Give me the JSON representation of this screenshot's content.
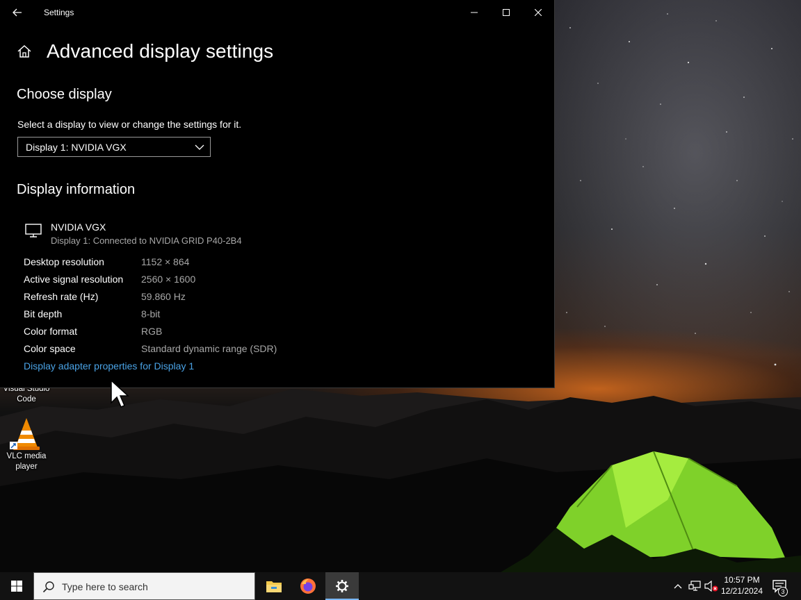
{
  "window": {
    "title": "Settings",
    "page_title": "Advanced display settings"
  },
  "choose_display": {
    "heading": "Choose display",
    "description": "Select a display to view or change the settings for it.",
    "selected": "Display 1: NVIDIA VGX"
  },
  "display_info": {
    "heading": "Display information",
    "monitor_name": "NVIDIA VGX",
    "monitor_subtitle": "Display 1: Connected to NVIDIA GRID P40-2B4",
    "rows": [
      {
        "label": "Desktop resolution",
        "value": "1152 × 864"
      },
      {
        "label": "Active signal resolution",
        "value": "2560 × 1600"
      },
      {
        "label": "Refresh rate (Hz)",
        "value": "59.860 Hz"
      },
      {
        "label": "Bit depth",
        "value": "8-bit"
      },
      {
        "label": "Color format",
        "value": "RGB"
      },
      {
        "label": "Color space",
        "value": "Standard dynamic range (SDR)"
      }
    ],
    "adapter_link": "Display adapter properties for Display 1"
  },
  "desktop_icons": {
    "vscode_label": "Visual Studio Code",
    "vlc_label": "VLC media player"
  },
  "taskbar": {
    "search_placeholder": "Type here to search",
    "time": "10:57 PM",
    "date": "12/21/2024",
    "notification_count": "3"
  },
  "colors": {
    "link": "#4aa3e6",
    "window_bg": "#000000",
    "taskbar_bg": "#121212"
  },
  "icons": [
    "back-arrow-icon",
    "minimize-icon",
    "maximize-icon",
    "close-icon",
    "home-icon",
    "chevron-down-icon",
    "monitor-icon",
    "windows-logo-icon",
    "search-icon",
    "file-explorer-icon",
    "firefox-icon",
    "settings-gear-icon",
    "chevron-up-icon",
    "network-icon",
    "volume-muted-icon",
    "notification-icon",
    "vlc-icon",
    "mouse-cursor"
  ]
}
